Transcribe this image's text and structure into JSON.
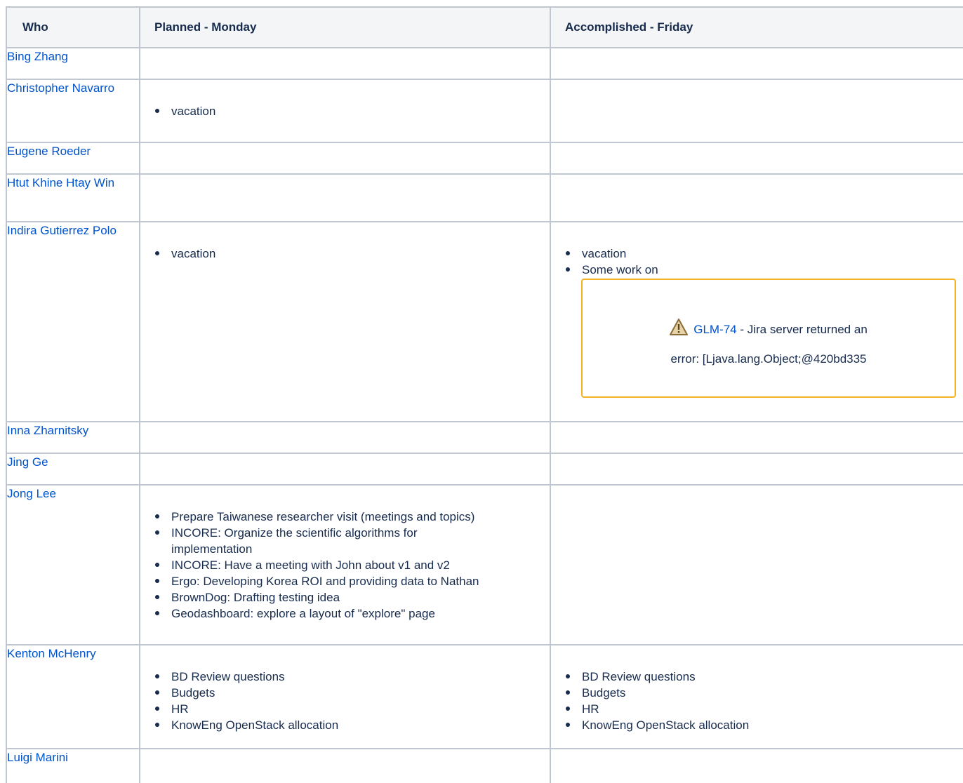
{
  "headers": {
    "who": "Who",
    "planned": "Planned - Monday",
    "accomplished": "Accomplished - Friday"
  },
  "rows": [
    {
      "name": "Bing Zhang",
      "planned": [],
      "accomplished": []
    },
    {
      "name": "Christopher Navarro",
      "planned": [
        "vacation"
      ],
      "accomplished": []
    },
    {
      "name": "Eugene Roeder",
      "planned": [],
      "accomplished": []
    },
    {
      "name": "Htut Khine Htay Win",
      "planned": [],
      "accomplished": []
    },
    {
      "name": "Indira Gutierrez Polo",
      "planned": [
        "vacation"
      ],
      "accomplished": [
        "vacation",
        "Some work on"
      ],
      "jira": {
        "key": "GLM-74",
        "message_part1": " - Jira server returned an",
        "message_part2": "error: [Ljava.lang.Object;@420bd335"
      }
    },
    {
      "name": "Inna Zharnitsky",
      "planned": [],
      "accomplished": []
    },
    {
      "name": "Jing Ge",
      "planned": [],
      "accomplished": []
    },
    {
      "name": "Jong Lee",
      "planned": [
        "Prepare Taiwanese researcher visit (meetings and topics)",
        "INCORE: Organize the scientific algorithms for implementation",
        "INCORE: Have a meeting with John about v1 and v2",
        "Ergo: Developing Korea ROI and providing data to Nathan",
        "BrownDog: Drafting testing idea",
        "Geodashboard: explore a layout of \"explore\" page"
      ],
      "accomplished": []
    },
    {
      "name": "Kenton McHenry",
      "planned": [
        "BD Review questions",
        "Budgets",
        "HR",
        "KnowEng OpenStack allocation"
      ],
      "accomplished": [
        "BD Review questions",
        "Budgets",
        "HR",
        "KnowEng OpenStack allocation"
      ]
    },
    {
      "name": "Luigi Marini",
      "planned": [],
      "accomplished": []
    }
  ],
  "colors": {
    "link": "#0052cc",
    "border": "#c1c7d0",
    "header_bg": "#f4f5f7",
    "warning_border": "#f5b324"
  }
}
